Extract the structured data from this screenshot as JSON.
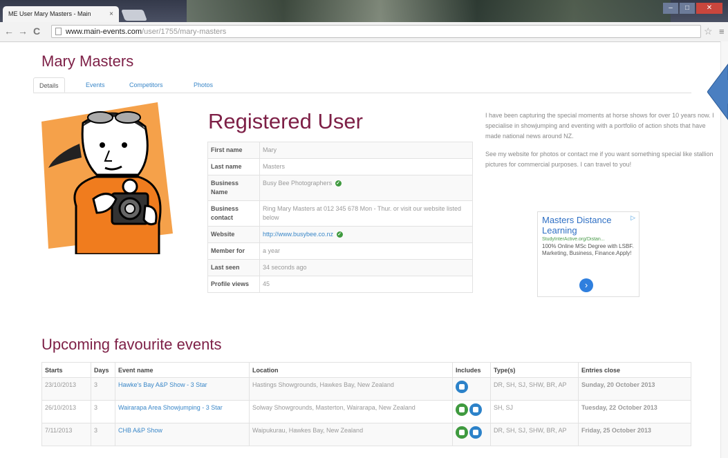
{
  "browser": {
    "tab_title": "ME User Mary Masters - Main",
    "tab_close": "×",
    "url_host": "www.main-events.com",
    "url_path": "/user/1755/mary-masters",
    "back": "←",
    "forward": "→",
    "reload": "C",
    "star": "☆",
    "menu": "≡"
  },
  "page": {
    "name": "Mary Masters",
    "tabs": [
      "Details",
      "Events",
      "Competitors",
      "Photos"
    ],
    "heading": "Registered User",
    "profile": [
      {
        "label": "First name",
        "value": "Mary"
      },
      {
        "label": "Last name",
        "value": "Masters"
      },
      {
        "label": "Business Name",
        "value": "Busy Bee Photographers"
      },
      {
        "label": "Business contact",
        "value": "Ring Mary Masters at 012 345 678 Mon - Thur. or visit our website listed below"
      },
      {
        "label": "Website",
        "value": "http://www.busybee.co.nz"
      },
      {
        "label": "Member for",
        "value": "a year"
      },
      {
        "label": "Last seen",
        "value": "34 seconds ago"
      },
      {
        "label": "Profile views",
        "value": "45"
      }
    ],
    "bio": [
      "I have been capturing the special moments at horse shows for over 10 years now. I specialise in showjumping and eventing with a portfolio of action shots that have made national news around NZ.",
      "See my website for photos or contact me if you want something special like stallion pictures for commercial purposes. I can travel to you!"
    ],
    "ad": {
      "title": "Masters Distance Learning",
      "url": "StudyInterActive.org/Distan...",
      "desc": "100% Online MSc Degree with LSBF. Marketing, Business, Finance.Apply!",
      "adchoice": "▷",
      "go": "›"
    },
    "upcoming_title": "Upcoming favourite events",
    "events_headers": [
      "Starts",
      "Days",
      "Event name",
      "Location",
      "Includes",
      "Type(s)",
      "Entries close"
    ],
    "events": [
      {
        "starts": "23/10/2013",
        "days": "3",
        "name": "Hawke's Bay A&P Show - 3 Star",
        "location": "Hastings Showgrounds, Hawkes Bay, New Zealand",
        "types": "DR, SH, SJ, SHW, BR, AP",
        "close": "Sunday, 20 October 2013",
        "icons": [
          "blue"
        ],
        "close_style": "red"
      },
      {
        "starts": "26/10/2013",
        "days": "3",
        "name": "Wairarapa Area Showjumping - 3 Star",
        "location": "Solway Showgrounds, Masterton, Wairarapa, New Zealand",
        "types": "SH, SJ",
        "close": "Tuesday, 22 October 2013",
        "icons": [
          "green",
          "blue"
        ],
        "close_style": "red"
      },
      {
        "starts": "7/11/2013",
        "days": "3",
        "name": "CHB A&P Show",
        "location": "Waipukurau, Hawkes Bay, New Zealand",
        "types": "DR, SH, SJ, SHW, BR, AP",
        "close": "Friday, 25 October 2013",
        "icons": [
          "green",
          "blue"
        ],
        "close_style": "orange"
      }
    ]
  }
}
